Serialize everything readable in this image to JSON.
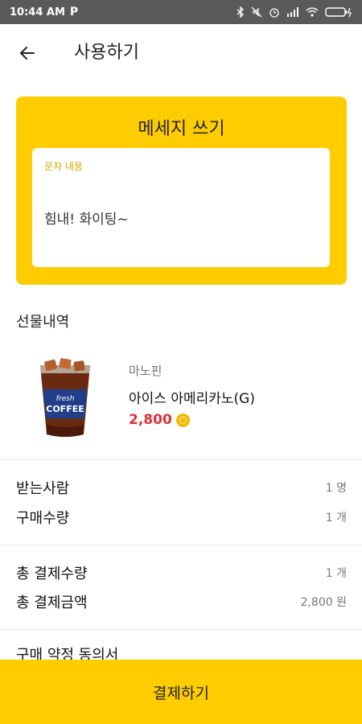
{
  "status_bar": {
    "time": "10:44 AM",
    "app_glyph": "P",
    "icons": [
      "bluetooth-icon",
      "mute-icon",
      "alarm-icon",
      "signal-icon",
      "wifi-icon",
      "battery-charging-icon"
    ]
  },
  "header": {
    "back_icon": "arrow-left-icon",
    "title": "사용하기"
  },
  "message_card": {
    "title": "메세지 쓰기",
    "field_label": "문자 내용",
    "message": "힘내! 화이팅~"
  },
  "gift": {
    "section_title": "선물내역",
    "brand": "마노핀",
    "product_name": "아이스 아메리카노(G)",
    "price": "2,800",
    "price_icon": "coin-icon",
    "image_icon": "iced-coffee-cup-icon"
  },
  "details": [
    {
      "label": "받는사람",
      "value": "1 명"
    },
    {
      "label": "구매수량",
      "value": "1 개"
    }
  ],
  "totals": [
    {
      "label": "총 결제수량",
      "value": "1 개"
    },
    {
      "label": "총 결제금액",
      "value": "2,800 원"
    }
  ],
  "agreement_title": "구매 약정 동의서",
  "pay_button_label": "결제하기",
  "colors": {
    "accent": "#ffcc00",
    "price": "#e03030",
    "status_bar": "#5a5a5a"
  }
}
